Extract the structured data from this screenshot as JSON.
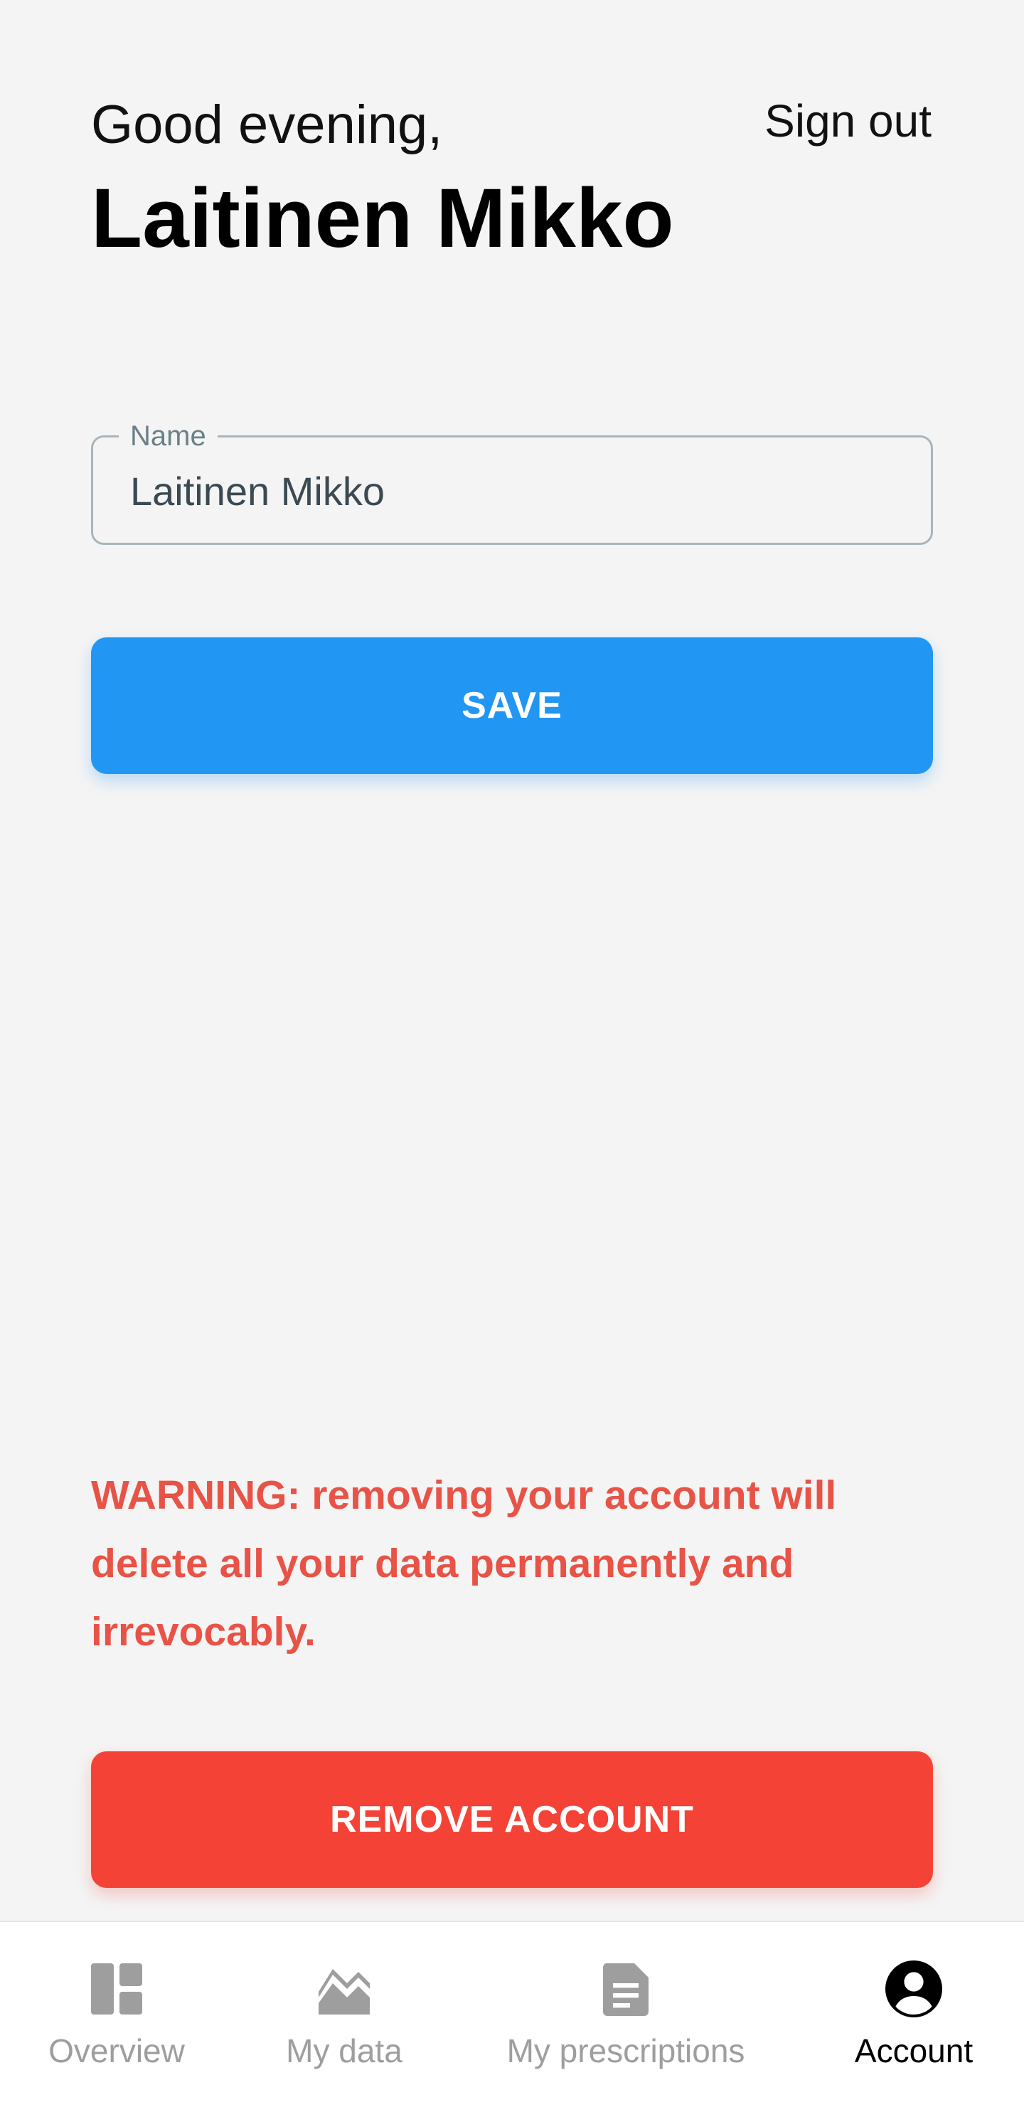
{
  "header": {
    "greeting": "Good evening,",
    "user_name": "Laitinen Mikko",
    "sign_out_label": "Sign out"
  },
  "form": {
    "name_label": "Name",
    "name_value": "Laitinen Mikko",
    "save_label": "SAVE"
  },
  "danger_zone": {
    "warning": "WARNING: removing your account will delete all your data permanently and irrevocably.",
    "remove_label": "REMOVE ACCOUNT"
  },
  "nav": {
    "items": [
      {
        "label": "Overview",
        "icon": "dashboard-icon",
        "active": false
      },
      {
        "label": "My data",
        "icon": "chart-icon",
        "active": false
      },
      {
        "label": "My prescriptions",
        "icon": "document-icon",
        "active": false
      },
      {
        "label": "Account",
        "icon": "account-circle-icon",
        "active": true
      }
    ]
  },
  "colors": {
    "primary": "#2196f3",
    "danger": "#f44336",
    "warning_text": "#e85347",
    "background": "#f4f4f4"
  }
}
